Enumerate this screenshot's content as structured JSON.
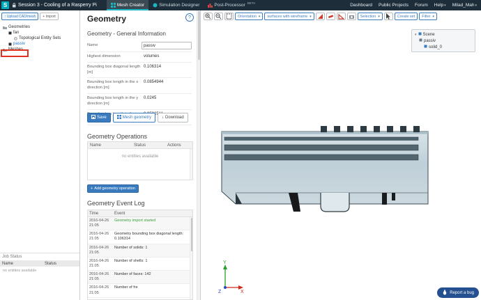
{
  "ui": {
    "caret": "▾",
    "plus": "+",
    "up_arrow": "↑",
    "down_arrow": "↓"
  },
  "topbar": {
    "logo_text": "S",
    "session_title": "Session 3 - Cooling of a Rasperry Pi",
    "tabs": [
      {
        "label": "Mesh Creator"
      },
      {
        "label": "Simulation Designer"
      },
      {
        "label": "Post-Processor",
        "badge": "BETA"
      }
    ],
    "nav": [
      {
        "label": "Dashboard"
      },
      {
        "label": "Public Projects"
      },
      {
        "label": "Forum"
      },
      {
        "label": "Help"
      },
      {
        "label": "Milad_Mah"
      }
    ]
  },
  "sidebar": {
    "upload_button": "Upload CAD/mesh",
    "import_button": "Import",
    "tree": {
      "items": [
        {
          "label": "Geometries"
        },
        {
          "label": "fan"
        },
        {
          "label": "Topological Entity Sets"
        },
        {
          "label": "passiv"
        },
        {
          "label": "Meshes"
        }
      ]
    },
    "job_status": {
      "title": "Job Status",
      "columns": [
        "Name",
        "Status"
      ],
      "empty_text": "no entities available"
    }
  },
  "panel": {
    "title": "Geometry",
    "help_label": "?",
    "general_info": {
      "heading": "Geometry - General Information",
      "name_label": "Name",
      "name_value": "passiv",
      "rows": [
        {
          "label": "Highest dimension",
          "value": "volumes"
        },
        {
          "label": "Bounding box diagonal length [m]",
          "value": "0.106314"
        },
        {
          "label": "Bounding box length in the x direction [m]",
          "value": "0.0854944"
        },
        {
          "label": "Bounding box length in the y direction [m]",
          "value": "0.0245"
        },
        {
          "label": "Bounding box length in the z direction [m]",
          "value": "0.0582511"
        }
      ]
    },
    "actions": {
      "save": "Save",
      "mesh_geometry": "Mesh geometry",
      "download": "Download"
    },
    "operations": {
      "heading": "Geometry Operations",
      "columns": [
        "Name",
        "Status",
        "Actions"
      ],
      "empty_text": "no entities available",
      "add_button": "Add geometry operation"
    },
    "event_log": {
      "heading": "Geometry Event Log",
      "columns": [
        "Time",
        "Event"
      ],
      "rows": [
        {
          "time": "2016-04-26 21:05",
          "event": "Geometry import started"
        },
        {
          "time": "2016-04-26 21:05",
          "event": "Geometry bounding box diagonal length: 0.106314"
        },
        {
          "time": "2016-04-26 21:05",
          "event": "Number of solids: 1"
        },
        {
          "time": "2016-04-26 21:05",
          "event": "Number of shells: 1"
        },
        {
          "time": "2016-04-26 21:05",
          "event": "Number of faces: 142"
        },
        {
          "time": "2016-04-26 21:05",
          "event": "Number of fre"
        }
      ]
    }
  },
  "viewer": {
    "toolbar": {
      "orientation_label": "Orientation",
      "render_mode_label": "surfaces with wireframe",
      "selection_label": "Selection",
      "create_set_label": "Create set",
      "filter_label": "Filter"
    },
    "scene_tree": {
      "root_label": "Scene",
      "child_label": "passiv",
      "grandchild_label": "solid_0"
    },
    "axes": {
      "x_label": "X",
      "y_label": "Y",
      "z_label": "Z"
    },
    "report_bug_label": "Report a bug"
  },
  "colors": {
    "topbar_bg": "#1d2d39",
    "logo_teal": "#00a9b7",
    "accent_blue": "#3a7bbf",
    "success_green": "#3a9e3a",
    "annotation_red": "#e0301e",
    "model_fill": "#c3d4dc",
    "model_edge": "#3c4a52",
    "axis_x": "#cc2a1d",
    "axis_y": "#2b9e2b",
    "axis_z": "#2a46c8"
  }
}
